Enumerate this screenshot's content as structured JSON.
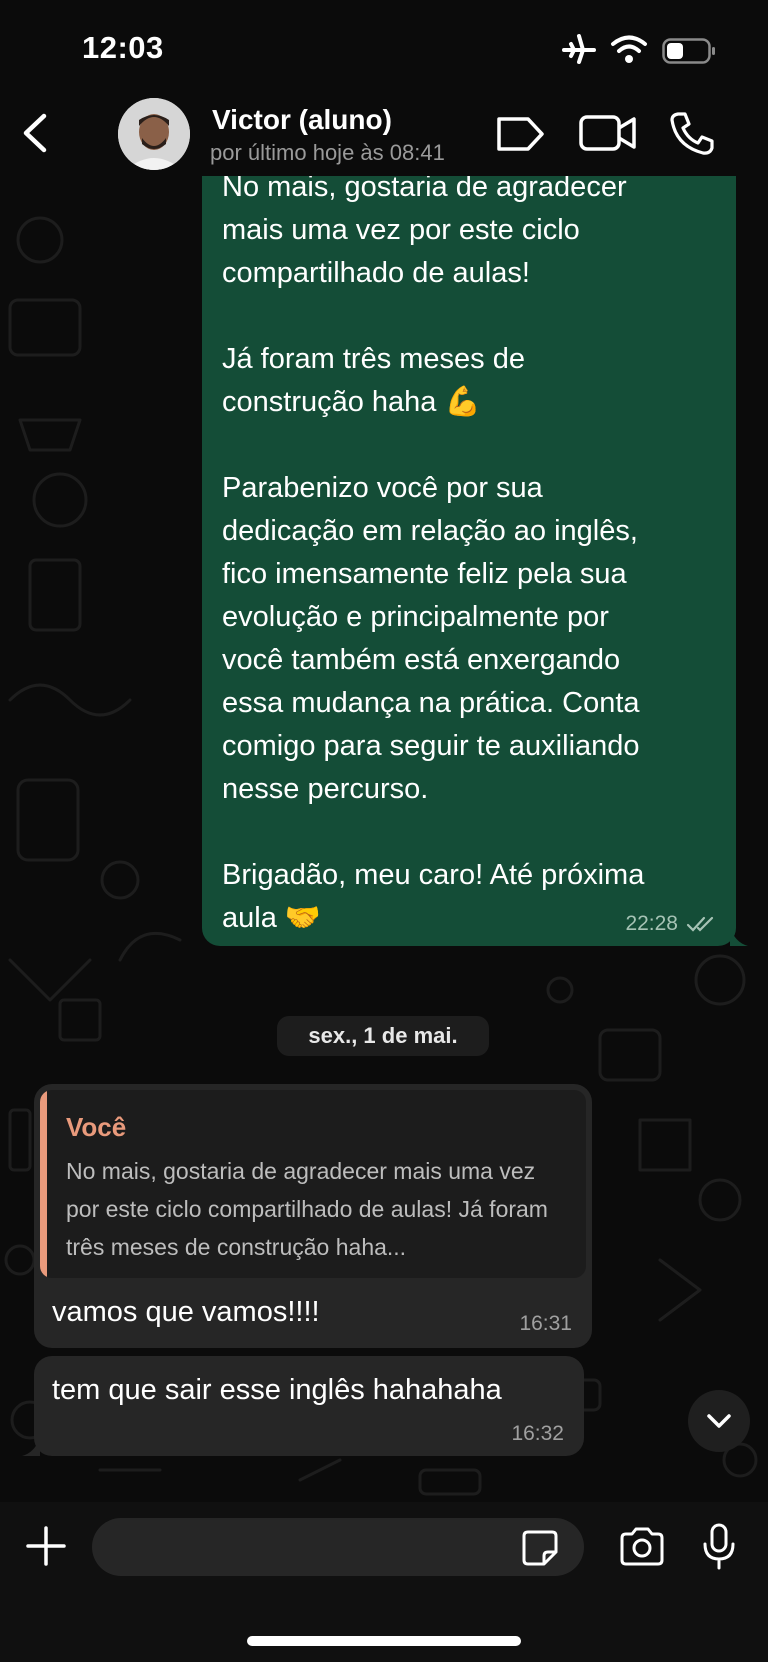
{
  "status_bar": {
    "time": "12:03"
  },
  "header": {
    "contact_name": "Victor (aluno)",
    "last_seen": "por último hoje às 08:41"
  },
  "messages": {
    "outgoing_1": {
      "text": "No mais, gostaria de agradecer\nmais uma vez por este ciclo\ncompartilhado de aulas!\n\nJá foram três meses de\nconstrução haha 💪\n\nParabenizo você por sua\ndedicação em relação ao inglês,\nfico imensamente feliz pela sua\nevolução e principalmente por\nvocê também está enxergando\nessa mudança na prática. Conta\ncomigo para seguir te auxiliando\nnesse percurso.\n\nBrigadão, meu caro! Até próxima\naula 🤝",
      "time": "22:28"
    },
    "date_separator": "sex., 1 de mai.",
    "incoming_1": {
      "quote_author": "Você",
      "quote_text": "No mais, gostaria de agradecer mais uma vez por este ciclo compartilhado de aulas! Já foram três meses de construção haha...",
      "text": "vamos que vamos!!!!",
      "time": "16:31"
    },
    "incoming_2": {
      "text": "tem que sair esse inglês hahahaha",
      "time": "16:32"
    }
  },
  "composer": {
    "placeholder": ""
  },
  "colors": {
    "outgoing_bubble": "#144d37",
    "incoming_bubble": "#262626",
    "quote_accent": "#e99a7c",
    "background": "#0b0b0b"
  },
  "icons": [
    "back-icon",
    "label-icon",
    "video-icon",
    "phone-icon",
    "chevron-down-icon",
    "plus-icon",
    "sticker-icon",
    "camera-icon",
    "mic-icon",
    "read-receipt-icon",
    "airplane-icon",
    "wifi-icon",
    "battery-icon"
  ]
}
